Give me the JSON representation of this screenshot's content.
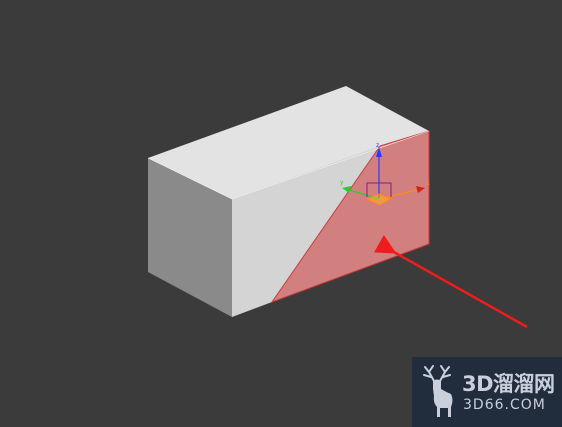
{
  "viewport": {
    "background": "#3b3b3b"
  },
  "box": {
    "top_face_color": "#e3e3e3",
    "front_face_color": "#d6d6d6",
    "left_face_color": "#8a8a8a",
    "selection_color": "#e08585",
    "selection_edge_color": "#cc3b3b"
  },
  "gizmo": {
    "x_label": "x",
    "y_label": "y",
    "z_label": "z",
    "x_color": "#ff8a1a",
    "y_color": "#2ecc2e",
    "z_color": "#2a3bff"
  },
  "annotation": {
    "arrow_color": "#ee1c1c",
    "icon": "red-arrow-icon"
  },
  "watermark": {
    "logo_icon": "deer-logo-icon",
    "title": "3D溜溜网",
    "subtitle": "3D66.COM",
    "background": "#1e2a3e"
  }
}
